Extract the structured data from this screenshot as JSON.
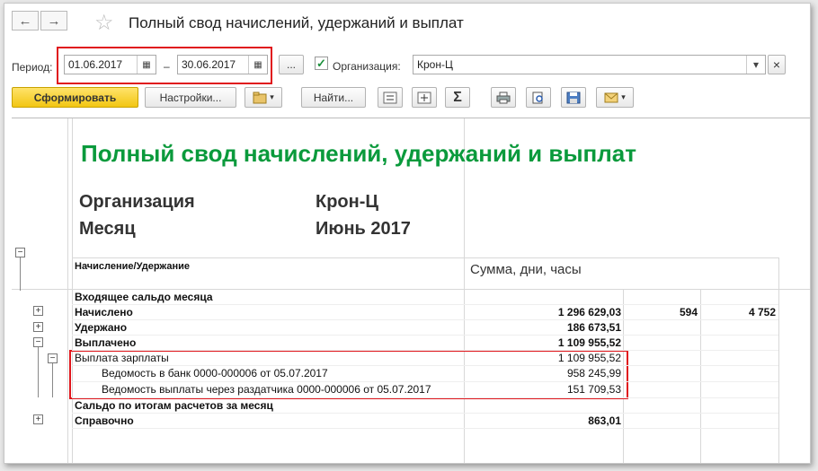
{
  "window": {
    "title": "Полный свод начислений, удержаний и выплат"
  },
  "nav": {
    "back_glyph": "←",
    "forward_glyph": "→",
    "star_glyph": "☆"
  },
  "period": {
    "label": "Период:",
    "from": "01.06.2017",
    "dash": "–",
    "to": "30.06.2017",
    "more": "...",
    "calendar_glyph": "▦"
  },
  "org": {
    "checkbox_glyph": "✓",
    "label": "Организация:",
    "value": "Крон-Ц",
    "dropdown_glyph": "▾",
    "clear_glyph": "×"
  },
  "toolbar": {
    "generate": "Сформировать",
    "settings": "Настройки...",
    "find": "Найти...",
    "sum_glyph": "Σ",
    "caret_glyph": "▾"
  },
  "report": {
    "heading": "Полный свод начислений, удержаний и выплат",
    "org_label": "Организация",
    "org_value": "Крон-Ц",
    "month_label": "Месяц",
    "month_value": "Июнь 2017",
    "col_header_1": "Начисление/Удержание",
    "col_header_2": "Сумма, дни, часы",
    "rows": [
      {
        "label": "Входящее сальдо месяца",
        "c1": "",
        "c2": "",
        "c3": ""
      },
      {
        "label": "Начислено",
        "c1": "1 296 629,03",
        "c2": "594",
        "c3": "4 752"
      },
      {
        "label": "Удержано",
        "c1": "186 673,51",
        "c2": "",
        "c3": ""
      },
      {
        "label": "Выплачено",
        "c1": "1 109 955,52",
        "c2": "",
        "c3": ""
      },
      {
        "label": "Выплата зарплаты",
        "c1": "1 109 955,52",
        "c2": "",
        "c3": ""
      },
      {
        "label": "Ведомость в банк 0000-000006 от 05.07.2017",
        "c1": "958 245,99",
        "c2": "",
        "c3": ""
      },
      {
        "label": "Ведомость выплаты через раздатчика 0000-000006 от 05.07.2017",
        "c1": "151 709,53",
        "c2": "",
        "c3": ""
      },
      {
        "label": "Сальдо по итогам расчетов за месяц",
        "c1": "",
        "c2": "",
        "c3": ""
      },
      {
        "label": "Справочно",
        "c1": "863,01",
        "c2": "",
        "c3": ""
      }
    ],
    "plus_glyph": "+",
    "minus_glyph": "−"
  },
  "colors": {
    "accent_green": "#0a9a3c",
    "highlight_red": "#e0161c",
    "primary_button": "#f5cc1c"
  }
}
